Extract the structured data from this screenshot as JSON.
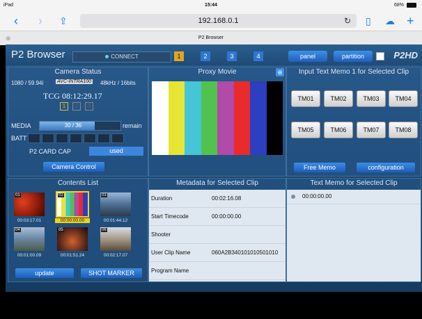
{
  "ios": {
    "device": "iPad",
    "time": "15:44",
    "battery": "68%",
    "url": "192.168.0.1",
    "tab_title": "P2 Browser"
  },
  "app": {
    "brand": "P2 Browser",
    "connect_label": "CONNECT",
    "slots": [
      "1",
      "2",
      "3",
      "4"
    ],
    "panel_label": "panel",
    "partition_label": "partition",
    "logo": "P2HD",
    "camera_status": {
      "title": "Camera Status",
      "format": "1080 / 59.94i",
      "codec": "AVC-INTRA100",
      "audio": "48kHz / 16bits",
      "tcg": "TCG 08:12:29.17",
      "card_slots": [
        "1",
        "2",
        "3"
      ],
      "media_label": "MEDIA",
      "media_value": "30 / 36",
      "media_fill": 0.82,
      "remain_label": "remain",
      "batt_label": "BATT",
      "batt_level": 0,
      "p2cap_label": "P2 CARD CAP",
      "p2cap_value": "used",
      "camera_control_label": "Camera Control"
    },
    "proxy": {
      "title": "Proxy Movie",
      "bars": [
        "#ffffff",
        "#e6e534",
        "#45c5d8",
        "#52c24f",
        "#b14aa8",
        "#ea2b2b",
        "#2b3fc0",
        "#000000"
      ]
    },
    "memo_input": {
      "title": "Input Text Memo 1 for Selected Clip",
      "buttons": [
        "TM01",
        "TM02",
        "TM03",
        "TM04",
        "TM05",
        "TM06",
        "TM07",
        "TM08"
      ],
      "free_memo_label": "Free Memo",
      "configuration_label": "configuration"
    },
    "contents": {
      "title": "Contents List",
      "clips": [
        {
          "num": "01",
          "tc": "00:03:17.01"
        },
        {
          "num": "02",
          "tc": "00:00:00.00"
        },
        {
          "num": "03",
          "tc": "00:01:44.12"
        },
        {
          "num": "04",
          "tc": "00:01:00.09"
        },
        {
          "num": "05",
          "tc": "00:01:51.24"
        },
        {
          "num": "06",
          "tc": "00:02:17.07"
        }
      ],
      "update_label": "update",
      "shot_marker_label": "SHOT MARKER"
    },
    "metadata": {
      "title": "Metadata for Selected Clip",
      "rows": [
        {
          "key": "Duration",
          "value": "00:02:16.08"
        },
        {
          "key": "Start Timecode",
          "value": "00:00:00.00"
        },
        {
          "key": "Shooter",
          "value": ""
        },
        {
          "key": "User Clip Name",
          "value": "060A2B340101010501010"
        },
        {
          "key": "Program Name",
          "value": ""
        }
      ]
    },
    "text_memo": {
      "title": "Text Memo for Selected Clip",
      "entries": [
        "00:00:00.00"
      ]
    }
  }
}
